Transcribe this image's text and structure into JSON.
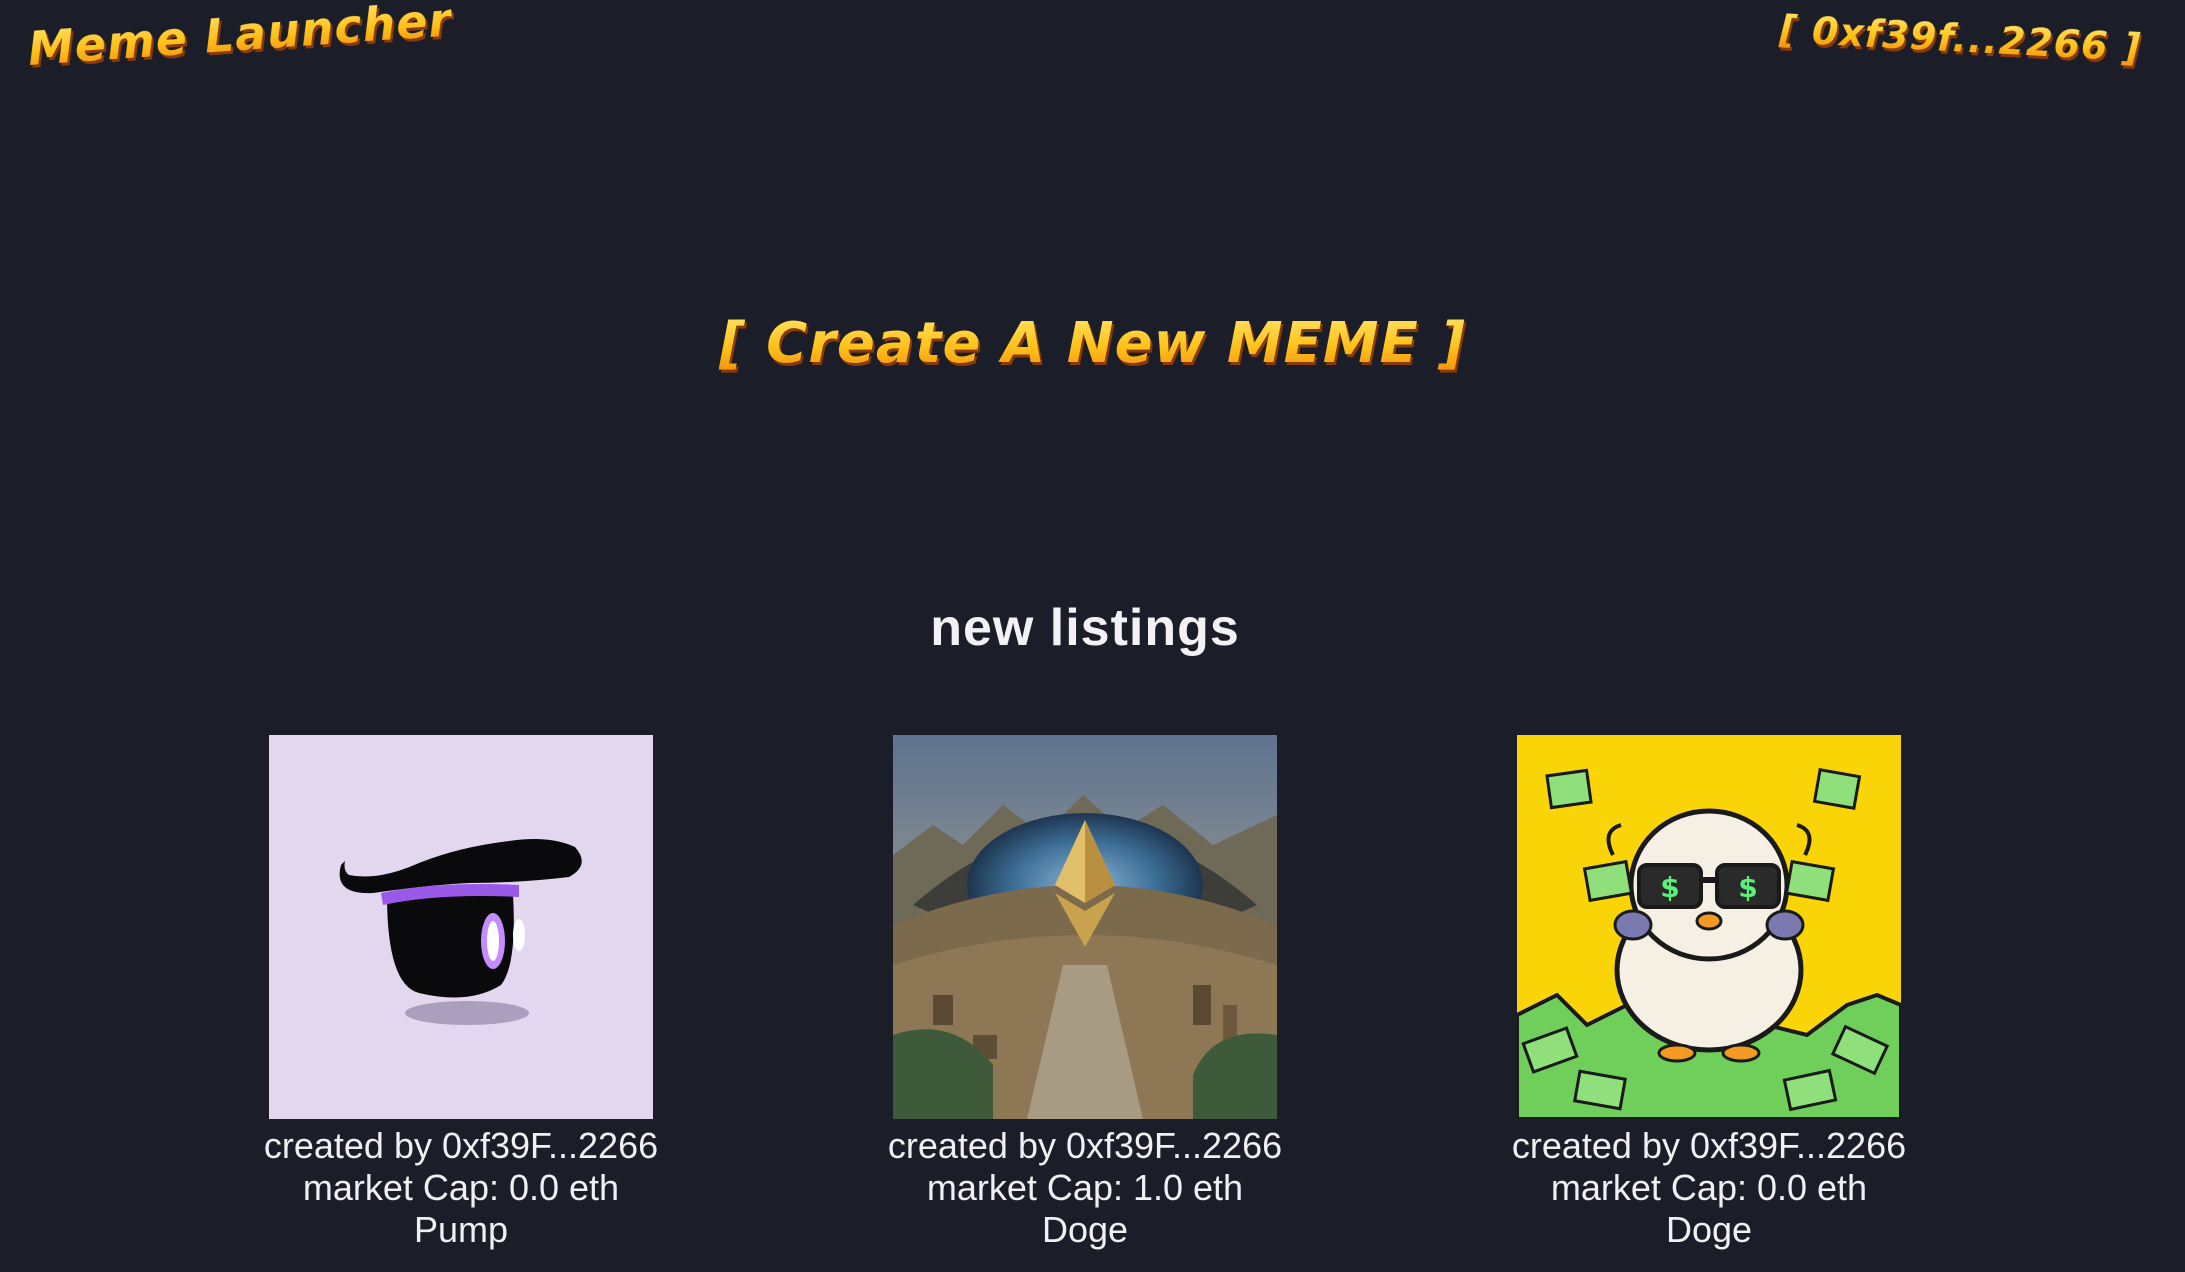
{
  "header": {
    "logo_text": "Meme Launcher",
    "wallet_label": "[ 0xf39f...2266 ]"
  },
  "hero": {
    "create_label": "[ Create A New MEME ]"
  },
  "listings": {
    "title": "new listings",
    "items": [
      {
        "image_icon": "purple-hat-mascot-image",
        "creator_text": "created by 0xf39F...2266",
        "market_cap_text": "market Cap: 0.0 eth",
        "name": "Pump"
      },
      {
        "image_icon": "ethereum-eye-landscape-image",
        "creator_text": "created by 0xf39F...2266",
        "market_cap_text": "market Cap: 1.0 eth",
        "name": "Doge"
      },
      {
        "image_icon": "money-duck-sunglasses-image",
        "creator_text": "created by 0xf39F...2266",
        "market_cap_text": "market Cap: 0.0 eth",
        "name": "Doge"
      }
    ]
  },
  "colors": {
    "background": "#1b1d28",
    "accent_gold": "#ffc21a",
    "text": "#f0f0f2"
  }
}
